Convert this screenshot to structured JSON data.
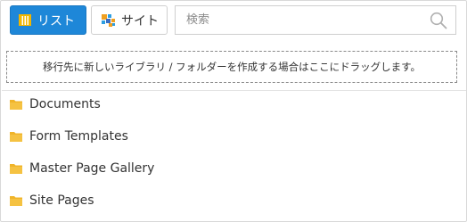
{
  "toolbar": {
    "list_tab_label": "リスト",
    "site_tab_label": "サイト",
    "active_tab": "list"
  },
  "search": {
    "placeholder": "検索",
    "value": ""
  },
  "dropzone": {
    "message": "移行先に新しいライブラリ / フォルダーを作成する場合はここにドラッグします。"
  },
  "folders": [
    {
      "label": "Documents"
    },
    {
      "label": "Form Templates"
    },
    {
      "label": "Master Page Gallery"
    },
    {
      "label": "Site Pages"
    }
  ],
  "colors": {
    "accent": "#1e87d8",
    "folder": "#f0b429",
    "border": "#cfcfcf"
  },
  "icons": {
    "list_tab": "list-view-icon",
    "site_tab": "site-icon",
    "search": "search-icon",
    "folder": "folder-icon"
  }
}
